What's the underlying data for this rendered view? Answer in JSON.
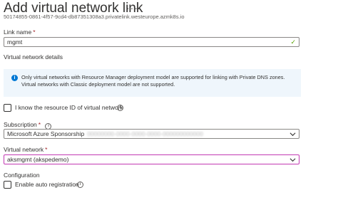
{
  "header": {
    "title": "Add virtual network link",
    "more_icon": "ellipsis-icon",
    "subtitle": "50174855-0861-4f57-9cd4-db87351308a3.privatelink.westeurope.azmk8s.io"
  },
  "form": {
    "link_name": {
      "label": "Link name",
      "required_marker": "*",
      "value": "mgmt",
      "valid_icon": "checkmark-icon"
    },
    "vnet_details_heading": "Virtual network details",
    "info": {
      "icon": "info-icon",
      "line1": "Only virtual networks with Resource Manager deployment model are supported for linking with Private DNS zones.",
      "line2": "Virtual networks with Classic deployment model are not supported."
    },
    "know_resource_id": {
      "label": "I know the resource ID of virtual network",
      "checked": false
    },
    "subscription": {
      "label": "Subscription",
      "required_marker": "*",
      "value": "Microsoft Azure Sponsorship",
      "redacted_suffix": "00000000-0000-0000-0000-000000000000"
    },
    "virtual_network": {
      "label": "Virtual network",
      "required_marker": "*",
      "value": "aksmgmt (akspedemo)"
    },
    "configuration_heading": "Configuration",
    "auto_registration": {
      "label": "Enable auto registration",
      "checked": false
    }
  },
  "colors": {
    "focus_border": "#c239b3",
    "info_bg": "#eff6fc",
    "info_icon": "#0078d4",
    "valid_check": "#57a300",
    "required": "#a4262c"
  }
}
